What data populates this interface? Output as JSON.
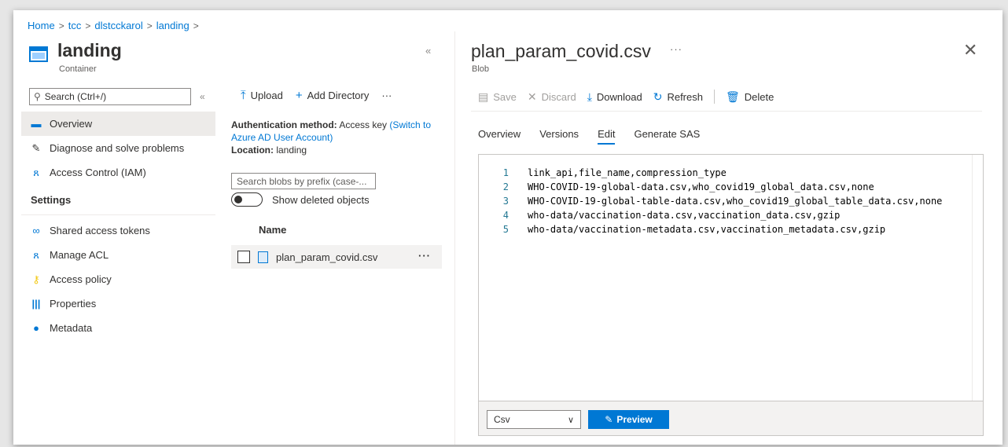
{
  "breadcrumb": [
    "Home",
    "tcc",
    "dlstcckarol",
    "landing"
  ],
  "container": {
    "title": "landing",
    "subtitle": "Container"
  },
  "left_search_placeholder": "Search (Ctrl+/)",
  "nav": {
    "items": [
      {
        "label": "Overview",
        "icon": "container-icon"
      },
      {
        "label": "Diagnose and solve problems",
        "icon": "wrench-icon"
      },
      {
        "label": "Access Control (IAM)",
        "icon": "people-icon"
      }
    ],
    "settings_label": "Settings",
    "settings_items": [
      {
        "label": "Shared access tokens",
        "icon": "link-icon"
      },
      {
        "label": "Manage ACL",
        "icon": "people-icon"
      },
      {
        "label": "Access policy",
        "icon": "key-icon"
      },
      {
        "label": "Properties",
        "icon": "bars-icon"
      },
      {
        "label": "Metadata",
        "icon": "info-icon"
      }
    ]
  },
  "middle": {
    "upload_label": "Upload",
    "add_directory_label": "Add Directory",
    "auth_label": "Authentication method:",
    "auth_value": "Access key",
    "auth_switch": "(Switch to Azure AD User Account)",
    "location_label": "Location:",
    "location_value": "landing",
    "prefix_placeholder": "Search blobs by prefix (case-...",
    "show_deleted_label": "Show deleted objects",
    "name_header": "Name",
    "blob_name": "plan_param_covid.csv"
  },
  "blob": {
    "title": "plan_param_covid.csv",
    "subtitle": "Blob",
    "toolbar": {
      "save": "Save",
      "discard": "Discard",
      "download": "Download",
      "refresh": "Refresh",
      "delete": "Delete"
    },
    "tabs": [
      "Overview",
      "Versions",
      "Edit",
      "Generate SAS"
    ],
    "active_tab": "Edit",
    "lines": [
      {
        "n": "1",
        "text": "link_api,file_name,compression_type"
      },
      {
        "n": "2",
        "text": "WHO-COVID-19-global-data.csv,who_covid19_global_data.csv,none"
      },
      {
        "n": "3",
        "text": "WHO-COVID-19-global-table-data.csv,who_covid19_global_table_data.csv,none"
      },
      {
        "n": "4",
        "text": "who-data/vaccination-data.csv,vaccination_data.csv,gzip"
      },
      {
        "n": "5",
        "text": "who-data/vaccination-metadata.csv,vaccination_metadata.csv,gzip"
      }
    ],
    "format_value": "Csv",
    "preview_label": "Preview"
  },
  "colors": {
    "accent": "#0078d4",
    "selected_bg": "#edebe9"
  }
}
